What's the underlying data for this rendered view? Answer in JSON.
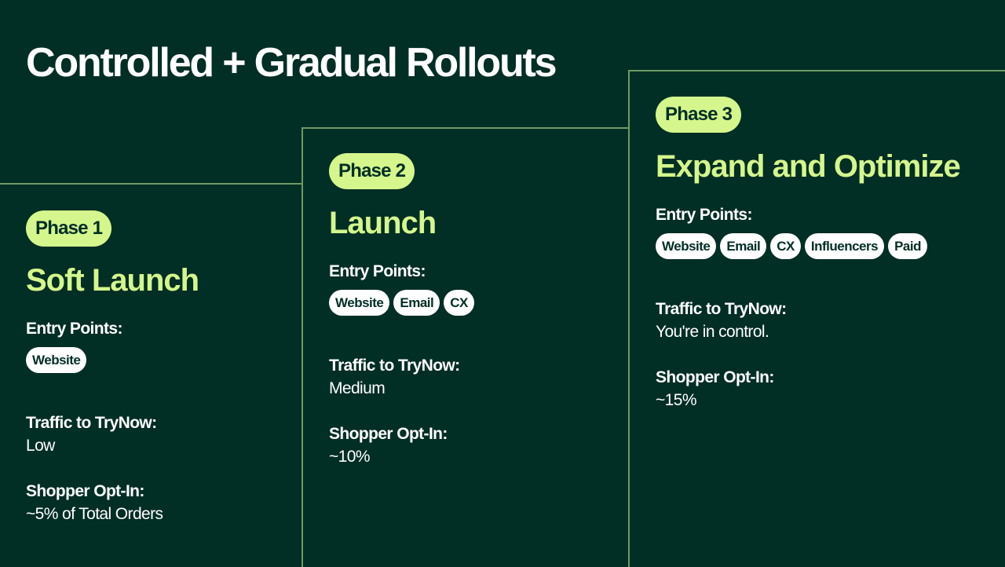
{
  "title": "Controlled + Gradual Rollouts",
  "phases": [
    {
      "pill": "Phase 1",
      "title": "Soft Launch",
      "entry_label": "Entry Points:",
      "entry_points": [
        "Website"
      ],
      "traffic_label": "Traffic to TryNow:",
      "traffic_value": "Low",
      "optin_label": "Shopper Opt-In:",
      "optin_value": "~5% of Total Orders"
    },
    {
      "pill": "Phase 2",
      "title": "Launch",
      "entry_label": "Entry Points:",
      "entry_points": [
        "Website",
        "Email",
        "CX"
      ],
      "traffic_label": "Traffic to TryNow:",
      "traffic_value": "Medium",
      "optin_label": "Shopper Opt-In:",
      "optin_value": "~10%"
    },
    {
      "pill": "Phase 3",
      "title": "Expand and Optimize",
      "entry_label": "Entry Points:",
      "entry_points": [
        "Website",
        "Email",
        "CX",
        "Influencers",
        "Paid"
      ],
      "traffic_label": "Traffic to TryNow:",
      "traffic_value": "You're in control.",
      "optin_label": "Shopper Opt-In:",
      "optin_value": "~15%"
    }
  ],
  "colors": {
    "background": "#012e25",
    "accent": "#d4f68c",
    "border": "#6f9a62",
    "text": "#ffffff"
  }
}
